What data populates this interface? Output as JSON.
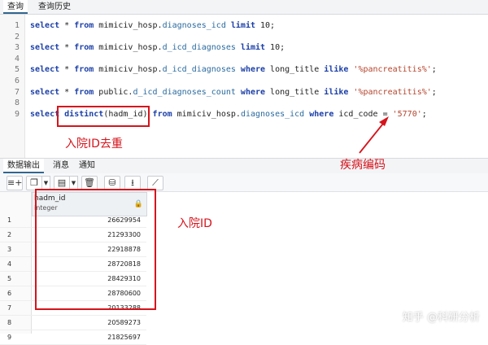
{
  "tabs_top": [
    {
      "label": "查询",
      "active": true
    },
    {
      "label": "查询历史",
      "active": false
    }
  ],
  "editor": {
    "lines": [
      {
        "num": "1",
        "parts": [
          {
            "t": "kw",
            "v": "select"
          },
          {
            "t": "txt",
            "v": " * "
          },
          {
            "t": "kw",
            "v": "from"
          },
          {
            "t": "txt",
            "v": " mimiciv_hosp."
          },
          {
            "t": "tbl",
            "v": "diagnoses_icd"
          },
          {
            "t": "txt",
            "v": " "
          },
          {
            "t": "kw",
            "v": "limit"
          },
          {
            "t": "txt",
            "v": " 10;"
          }
        ]
      },
      {
        "num": "2",
        "parts": []
      },
      {
        "num": "3",
        "parts": [
          {
            "t": "kw",
            "v": "select"
          },
          {
            "t": "txt",
            "v": " * "
          },
          {
            "t": "kw",
            "v": "from"
          },
          {
            "t": "txt",
            "v": " mimiciv_hosp."
          },
          {
            "t": "tbl",
            "v": "d_icd_diagnoses"
          },
          {
            "t": "txt",
            "v": " "
          },
          {
            "t": "kw",
            "v": "limit"
          },
          {
            "t": "txt",
            "v": " 10;"
          }
        ]
      },
      {
        "num": "4",
        "parts": []
      },
      {
        "num": "5",
        "parts": [
          {
            "t": "kw",
            "v": "select"
          },
          {
            "t": "txt",
            "v": " * "
          },
          {
            "t": "kw",
            "v": "from"
          },
          {
            "t": "txt",
            "v": " mimiciv_hosp."
          },
          {
            "t": "tbl",
            "v": "d_icd_diagnoses"
          },
          {
            "t": "txt",
            "v": " "
          },
          {
            "t": "kw",
            "v": "where"
          },
          {
            "t": "txt",
            "v": " long_title "
          },
          {
            "t": "kw",
            "v": "ilike"
          },
          {
            "t": "txt",
            "v": " "
          },
          {
            "t": "str",
            "v": "'%pancreatitis%'"
          },
          {
            "t": "txt",
            "v": ";"
          }
        ]
      },
      {
        "num": "6",
        "parts": []
      },
      {
        "num": "7",
        "parts": [
          {
            "t": "kw",
            "v": "select"
          },
          {
            "t": "txt",
            "v": " * "
          },
          {
            "t": "kw",
            "v": "from"
          },
          {
            "t": "txt",
            "v": " public."
          },
          {
            "t": "tbl",
            "v": "d_icd_diagnoses_count"
          },
          {
            "t": "txt",
            "v": " "
          },
          {
            "t": "kw",
            "v": "where"
          },
          {
            "t": "txt",
            "v": " long_title "
          },
          {
            "t": "kw",
            "v": "ilike"
          },
          {
            "t": "txt",
            "v": " "
          },
          {
            "t": "str",
            "v": "'%pancreatitis%'"
          },
          {
            "t": "txt",
            "v": ";"
          }
        ]
      },
      {
        "num": "8",
        "parts": []
      },
      {
        "num": "9",
        "parts": [
          {
            "t": "kw",
            "v": "select"
          },
          {
            "t": "txt",
            "v": " "
          },
          {
            "t": "kw",
            "v": "distinct"
          },
          {
            "t": "txt",
            "v": "(hadm_id) "
          },
          {
            "t": "kw",
            "v": "from"
          },
          {
            "t": "txt",
            "v": " mimiciv_hosp."
          },
          {
            "t": "tbl",
            "v": "diagnoses_icd"
          },
          {
            "t": "txt",
            "v": " "
          },
          {
            "t": "kw",
            "v": "where"
          },
          {
            "t": "txt",
            "v": " icd_code = "
          },
          {
            "t": "str",
            "v": "'5770'"
          },
          {
            "t": "txt",
            "v": ";"
          }
        ]
      }
    ]
  },
  "tabs_bottom": [
    {
      "label": "数据输出",
      "active": true
    },
    {
      "label": "消息",
      "active": false
    },
    {
      "label": "通知",
      "active": false
    }
  ],
  "toolbar": {
    "icons": [
      "add-row-icon",
      "copy-icon",
      "paste-icon",
      "delete-icon",
      "database-icon",
      "download-icon",
      "graph-icon"
    ]
  },
  "grid": {
    "column": {
      "name": "hadm_id",
      "type": "integer"
    },
    "rows": [
      {
        "n": "1",
        "v": "26629954"
      },
      {
        "n": "2",
        "v": "21293300"
      },
      {
        "n": "3",
        "v": "22918878"
      },
      {
        "n": "4",
        "v": "28720818"
      },
      {
        "n": "5",
        "v": "28429310"
      },
      {
        "n": "6",
        "v": "28780600"
      },
      {
        "n": "7",
        "v": "20133288"
      },
      {
        "n": "8",
        "v": "20589273"
      },
      {
        "n": "9",
        "v": "21825697"
      }
    ]
  },
  "annotations": {
    "distinct_note": "入院ID去重",
    "code_note": "疾病编码",
    "column_note": "入院ID"
  },
  "watermark": "知乎 @科研分析",
  "colors": {
    "annotation_red": "#d6141c",
    "keyword_blue": "#1b3fa8",
    "string_red": "#b4442c"
  }
}
